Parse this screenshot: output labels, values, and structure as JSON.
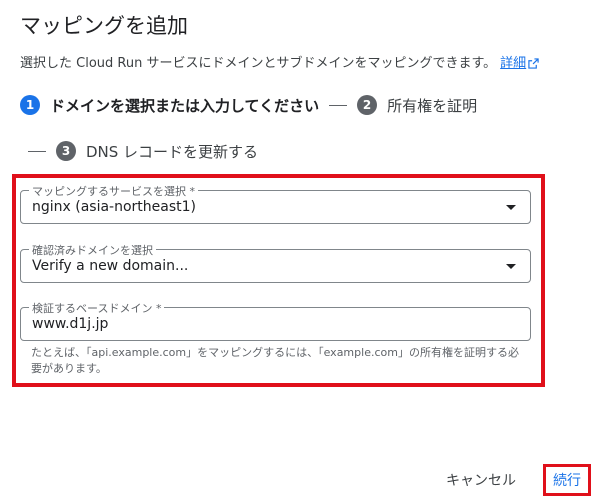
{
  "dialog": {
    "title": "マッピングを追加",
    "description": "選択した Cloud Run サービスにドメインとサブドメインをマッピングできます。",
    "details_link": "詳細"
  },
  "steps": [
    {
      "number": "1",
      "label": "ドメインを選択または入力してください"
    },
    {
      "number": "2",
      "label": "所有権を証明"
    },
    {
      "number": "3",
      "label": "DNS レコードを更新する"
    }
  ],
  "fields": {
    "service": {
      "label": "マッピングするサービスを選択 *",
      "value": "nginx (asia-northeast1)"
    },
    "domain": {
      "label": "確認済みドメインを選択",
      "value": "Verify a new domain..."
    },
    "base_domain": {
      "label": "検証するベースドメイン *",
      "value": "www.d1j.jp"
    }
  },
  "hint": "たとえば、「api.example.com」をマッピングするには、「example.com」の所有権を証明する必要があります。",
  "buttons": {
    "cancel": "キャンセル",
    "continue": "続行"
  },
  "colors": {
    "accent": "#1a73e8",
    "highlight": "#e0101a",
    "step_inactive": "#5f6368"
  }
}
